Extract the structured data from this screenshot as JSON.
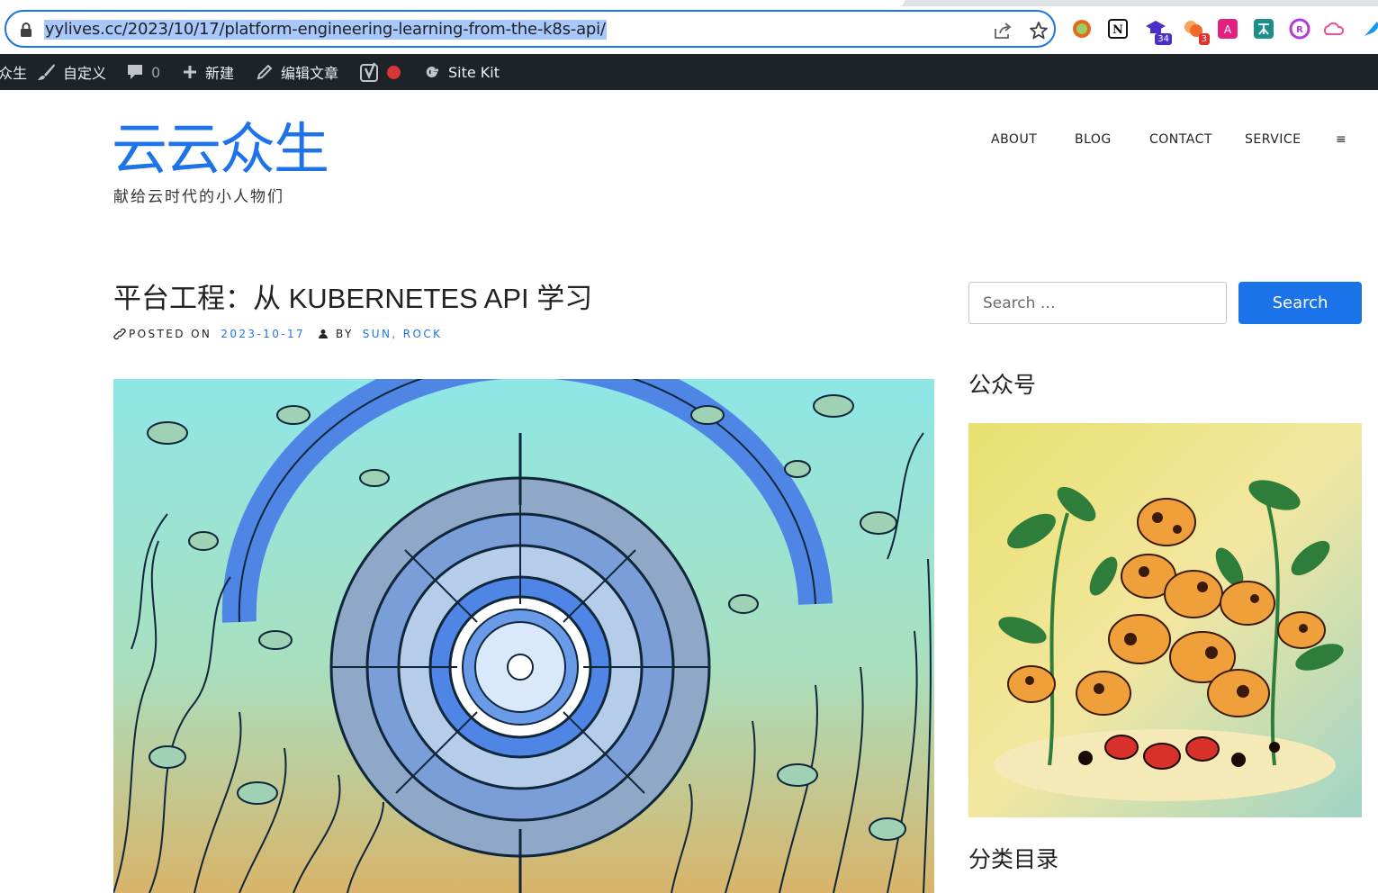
{
  "browser": {
    "url": "yylives.cc/2023/10/17/platform-engineering-learning-from-the-k8s-api/",
    "extensions": [
      {
        "icon": "ring-extension-icon",
        "color": "#e36b1f"
      },
      {
        "icon": "notion-icon",
        "color": "#111111"
      },
      {
        "icon": "graduation-cap-icon",
        "color": "#4b2ec5",
        "badge": "34"
      },
      {
        "icon": "fruit-extension-icon",
        "color": "#f06a2a",
        "badge": "3"
      },
      {
        "icon": "translate-icon",
        "color": "#e2207d"
      },
      {
        "icon": "translate-alt-icon",
        "color": "#1d8f8a"
      },
      {
        "icon": "circle-extension-icon",
        "color": "#b23ad9"
      },
      {
        "icon": "cloud-extension-icon",
        "color": "#f04d9a"
      },
      {
        "icon": "feather-icon",
        "color": "#1a96f0"
      }
    ]
  },
  "adminbar": {
    "site_fragment": "众生",
    "customize": "自定义",
    "comments_count": "0",
    "new": "新建",
    "edit_post": "编辑文章",
    "site_kit": "Site Kit"
  },
  "site": {
    "title": "云云众生",
    "description": "献给云时代的小人物们"
  },
  "nav": {
    "items": [
      "ABOUT",
      "BLOG",
      "CONTACT",
      "SERVICE"
    ],
    "menu_toggle": "≡"
  },
  "post": {
    "title": "平台工程：从 KUBERNETES API 学习",
    "posted_on_label": "POSTED ON",
    "date": "2023-10-17",
    "by_label": "BY",
    "authors": "SUN, ROCK"
  },
  "sidebar": {
    "search_placeholder": "Search …",
    "search_button": "Search",
    "widget_wechat": "公众号",
    "widget_categories": "分类目录"
  },
  "colors": {
    "accent": "#1e73e8",
    "adminbar": "#1d2327"
  }
}
